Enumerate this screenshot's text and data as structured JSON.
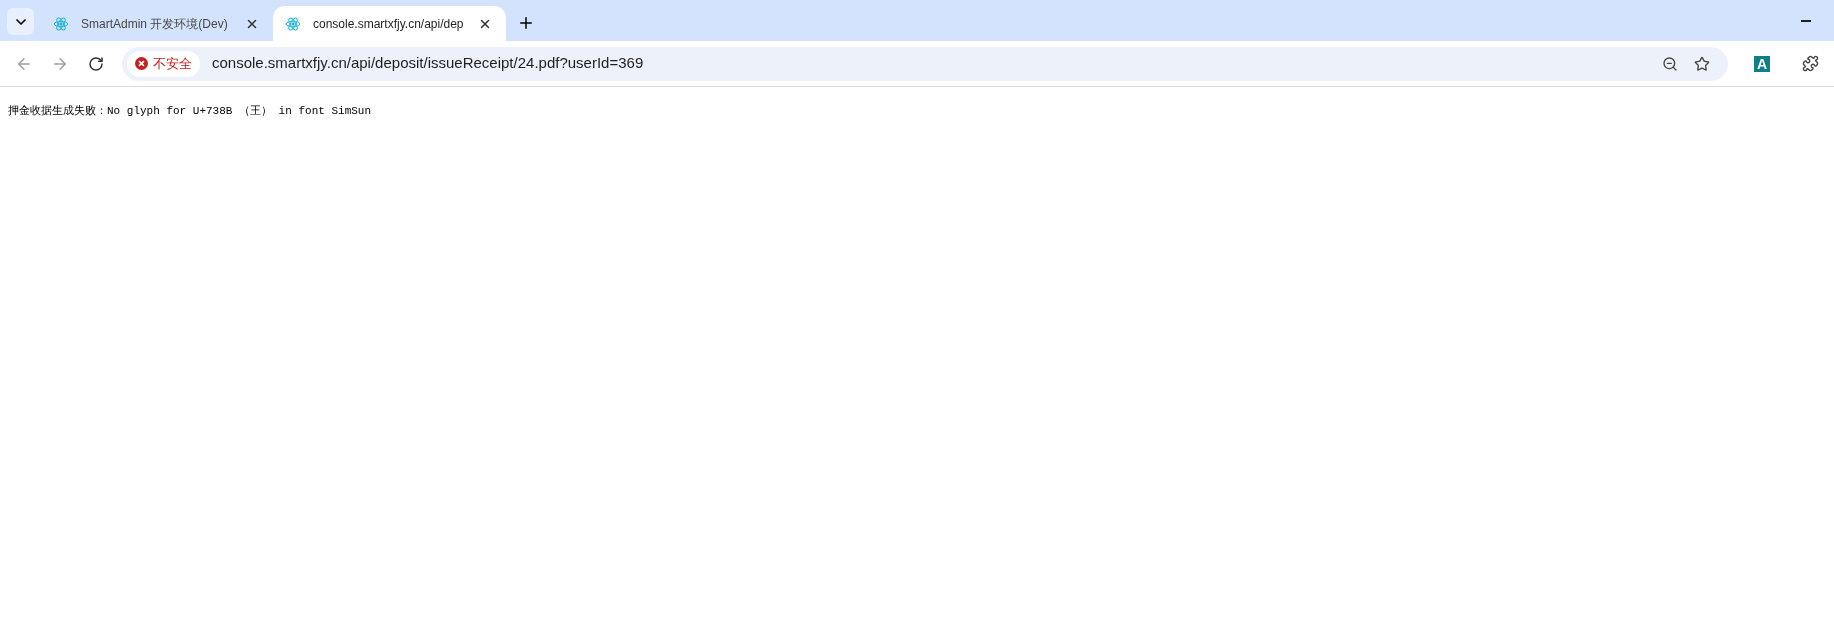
{
  "tabs": [
    {
      "title": "SmartAdmin 开发环境(Dev)",
      "selected": false
    },
    {
      "title": "console.smartxfjy.cn/api/dep",
      "selected": true
    }
  ],
  "address_bar": {
    "security_label": "不安全",
    "url": "console.smartxfjy.cn/api/deposit/issueReceipt/24.pdf?userId=369"
  },
  "extension": {
    "letter": "A"
  },
  "page": {
    "message": "押金收据生成失败：No glyph for U+738B （王） in font SimSun"
  }
}
